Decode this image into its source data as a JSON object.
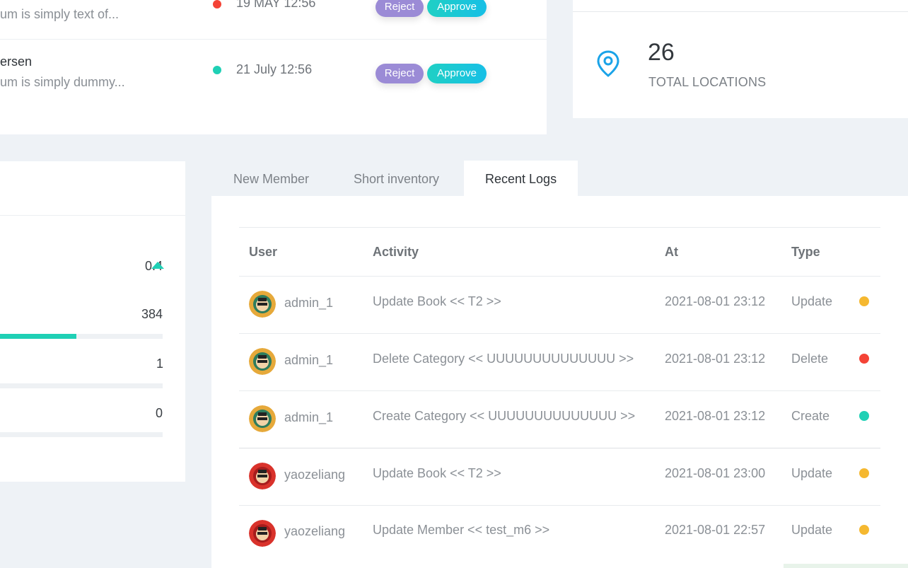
{
  "approvals": [
    {
      "name": "",
      "message": "um is simply text of...",
      "date": "19 MAY 12:56",
      "dot_color": "#f44336",
      "reject_label": "Reject",
      "approve_label": "Approve"
    },
    {
      "name": "ersen",
      "message": "um is simply dummy...",
      "date": "21 July 12:56",
      "dot_color": "#1fd0b5",
      "reject_label": "Reject",
      "approve_label": "Approve"
    }
  ],
  "locations": {
    "count": "26",
    "label": "TOTAL LOCATIONS",
    "icon": "location-pin-icon",
    "icon_color": "#1aa3e8"
  },
  "stats": [
    {
      "value": "0.4",
      "trend": "up"
    },
    {
      "value": "384",
      "progress": 0.47
    },
    {
      "value": "1",
      "progress": 0
    },
    {
      "value": "0",
      "progress": 0
    }
  ],
  "tabs": [
    {
      "label": "New Member",
      "active": false
    },
    {
      "label": "Short inventory",
      "active": false
    },
    {
      "label": "Recent Logs",
      "active": true
    }
  ],
  "logs": {
    "columns": [
      "User",
      "Activity",
      "At",
      "Type"
    ],
    "rows": [
      {
        "user": "admin_1",
        "activity": "Update Book << T2 >>",
        "at": "2021-08-01 23:12",
        "type": "Update",
        "type_color": "#f5b830",
        "avatar": "avatar-green"
      },
      {
        "user": "admin_1",
        "activity": "Delete Category << UUUUUUUUUUUUUU >>",
        "at": "2021-08-01 23:12",
        "type": "Delete",
        "type_color": "#f44336",
        "avatar": "avatar-green"
      },
      {
        "user": "admin_1",
        "activity": "Create Category << UUUUUUUUUUUUUU >>",
        "at": "2021-08-01 23:12",
        "type": "Create",
        "type_color": "#1fd0b5",
        "avatar": "avatar-green"
      },
      {
        "user": "yaozeliang",
        "activity": "Update Book << T2 >>",
        "at": "2021-08-01 23:00",
        "type": "Update",
        "type_color": "#f5b830",
        "avatar": "avatar-red"
      },
      {
        "user": "yaozeliang",
        "activity": "Update Member << test_m6 >>",
        "at": "2021-08-01 22:57",
        "type": "Update",
        "type_color": "#f5b830",
        "avatar": "avatar-red"
      }
    ]
  }
}
